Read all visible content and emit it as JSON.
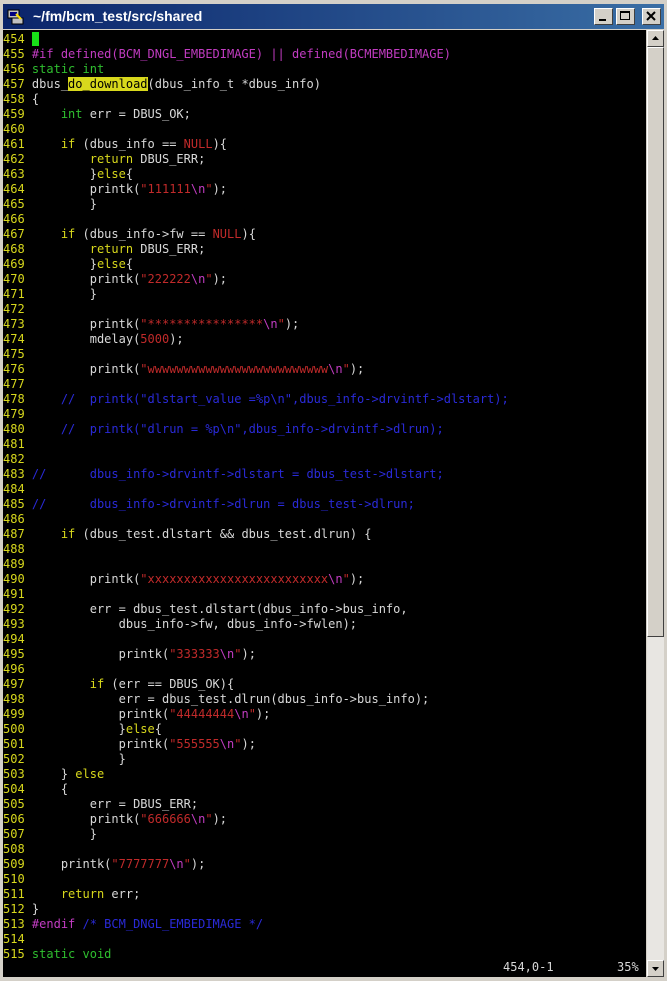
{
  "window": {
    "title": "~/fm/bcm_test/src/shared",
    "icon": "putty-terminal-icon"
  },
  "colors": {
    "linenum": "#d8d81c",
    "type": "#2fbf2f",
    "preproc": "#c23cc2",
    "keyword": "#d8d81c",
    "comment": "#2a2ad8",
    "string": "#c02a2a",
    "number": "#c02a2a",
    "special": "#c23cc2",
    "normal": "#d8d8d8",
    "search_hl": "#d8d81c",
    "cursor": "#18e018"
  },
  "lines": [
    {
      "n": "454",
      "cursor": true,
      "t": []
    },
    {
      "n": "455",
      "t": [
        [
          "pp",
          "#if defined(BCM_DNGL_EMBEDIMAGE) || defined(BCMEMBEDIMAGE)"
        ]
      ]
    },
    {
      "n": "456",
      "t": [
        [
          "ty",
          "static int"
        ]
      ]
    },
    {
      "n": "457",
      "t": [
        [
          "pl",
          "dbus_"
        ],
        [
          "hl",
          "do_download"
        ],
        [
          "pl",
          "(dbus_info_t *dbus_info)"
        ]
      ]
    },
    {
      "n": "458",
      "t": [
        [
          "pl",
          "{"
        ]
      ]
    },
    {
      "n": "459",
      "t": [
        [
          "pl",
          "    "
        ],
        [
          "ty",
          "int"
        ],
        [
          "pl",
          " err = DBUS_OK;"
        ]
      ]
    },
    {
      "n": "460",
      "t": []
    },
    {
      "n": "461",
      "t": [
        [
          "pl",
          "    "
        ],
        [
          "kw",
          "if"
        ],
        [
          "pl",
          " (dbus_info == "
        ],
        [
          "nul",
          "NULL"
        ],
        [
          "pl",
          "){"
        ]
      ]
    },
    {
      "n": "462",
      "t": [
        [
          "pl",
          "        "
        ],
        [
          "kw",
          "return"
        ],
        [
          "pl",
          " DBUS_ERR;"
        ]
      ]
    },
    {
      "n": "463",
      "t": [
        [
          "pl",
          "        }"
        ],
        [
          "kw",
          "else"
        ],
        [
          "pl",
          "{"
        ]
      ]
    },
    {
      "n": "464",
      "t": [
        [
          "pl",
          "        printk("
        ],
        [
          "st",
          "\"111111"
        ],
        [
          "sp",
          "\\n"
        ],
        [
          "st",
          "\""
        ],
        [
          "pl",
          ");"
        ]
      ]
    },
    {
      "n": "465",
      "t": [
        [
          "pl",
          "        }"
        ]
      ]
    },
    {
      "n": "466",
      "t": []
    },
    {
      "n": "467",
      "t": [
        [
          "pl",
          "    "
        ],
        [
          "kw",
          "if"
        ],
        [
          "pl",
          " (dbus_info->fw == "
        ],
        [
          "nul",
          "NULL"
        ],
        [
          "pl",
          "){"
        ]
      ]
    },
    {
      "n": "468",
      "t": [
        [
          "pl",
          "        "
        ],
        [
          "kw",
          "return"
        ],
        [
          "pl",
          " DBUS_ERR;"
        ]
      ]
    },
    {
      "n": "469",
      "t": [
        [
          "pl",
          "        }"
        ],
        [
          "kw",
          "else"
        ],
        [
          "pl",
          "{"
        ]
      ]
    },
    {
      "n": "470",
      "t": [
        [
          "pl",
          "        printk("
        ],
        [
          "st",
          "\"222222"
        ],
        [
          "sp",
          "\\n"
        ],
        [
          "st",
          "\""
        ],
        [
          "pl",
          ");"
        ]
      ]
    },
    {
      "n": "471",
      "t": [
        [
          "pl",
          "        }"
        ]
      ]
    },
    {
      "n": "472",
      "t": []
    },
    {
      "n": "473",
      "t": [
        [
          "pl",
          "        printk("
        ],
        [
          "st",
          "\"****************"
        ],
        [
          "sp",
          "\\n"
        ],
        [
          "st",
          "\""
        ],
        [
          "pl",
          ");"
        ]
      ]
    },
    {
      "n": "474",
      "t": [
        [
          "pl",
          "        mdelay("
        ],
        [
          "nu",
          "5000"
        ],
        [
          "pl",
          ");"
        ]
      ]
    },
    {
      "n": "475",
      "t": []
    },
    {
      "n": "476",
      "t": [
        [
          "pl",
          "        printk("
        ],
        [
          "st",
          "\"wwwwwwwwwwwwwwwwwwwwwwwww"
        ],
        [
          "sp",
          "\\n"
        ],
        [
          "st",
          "\""
        ],
        [
          "pl",
          ");"
        ]
      ]
    },
    {
      "n": "477",
      "t": []
    },
    {
      "n": "478",
      "t": [
        [
          "cm",
          "    //  printk(\"dlstart_value =%p\\n\",dbus_info->drvintf->dlstart);"
        ]
      ]
    },
    {
      "n": "479",
      "t": []
    },
    {
      "n": "480",
      "t": [
        [
          "cm",
          "    //  printk(\"dlrun = %p\\n\",dbus_info->drvintf->dlrun);"
        ]
      ]
    },
    {
      "n": "481",
      "t": []
    },
    {
      "n": "482",
      "t": []
    },
    {
      "n": "483",
      "t": [
        [
          "cm",
          "//      dbus_info->drvintf->dlstart = dbus_test->dlstart;"
        ]
      ]
    },
    {
      "n": "484",
      "t": []
    },
    {
      "n": "485",
      "t": [
        [
          "cm",
          "//      dbus_info->drvintf->dlrun = dbus_test->dlrun;"
        ]
      ]
    },
    {
      "n": "486",
      "t": []
    },
    {
      "n": "487",
      "t": [
        [
          "pl",
          "    "
        ],
        [
          "kw",
          "if"
        ],
        [
          "pl",
          " (dbus_test.dlstart && dbus_test.dlrun) {"
        ]
      ]
    },
    {
      "n": "488",
      "t": []
    },
    {
      "n": "489",
      "t": []
    },
    {
      "n": "490",
      "t": [
        [
          "pl",
          "        printk("
        ],
        [
          "st",
          "\"xxxxxxxxxxxxxxxxxxxxxxxxx"
        ],
        [
          "sp",
          "\\n"
        ],
        [
          "st",
          "\""
        ],
        [
          "pl",
          ");"
        ]
      ]
    },
    {
      "n": "491",
      "t": []
    },
    {
      "n": "492",
      "t": [
        [
          "pl",
          "        err = dbus_test.dlstart(dbus_info->bus_info,"
        ]
      ]
    },
    {
      "n": "493",
      "t": [
        [
          "pl",
          "            dbus_info->fw, dbus_info->fwlen);"
        ]
      ]
    },
    {
      "n": "494",
      "t": []
    },
    {
      "n": "495",
      "t": [
        [
          "pl",
          "            printk("
        ],
        [
          "st",
          "\"333333"
        ],
        [
          "sp",
          "\\n"
        ],
        [
          "st",
          "\""
        ],
        [
          "pl",
          ");"
        ]
      ]
    },
    {
      "n": "496",
      "t": []
    },
    {
      "n": "497",
      "t": [
        [
          "pl",
          "        "
        ],
        [
          "kw",
          "if"
        ],
        [
          "pl",
          " (err == DBUS_OK){"
        ]
      ]
    },
    {
      "n": "498",
      "t": [
        [
          "pl",
          "            err = dbus_test.dlrun(dbus_info->bus_info);"
        ]
      ]
    },
    {
      "n": "499",
      "t": [
        [
          "pl",
          "            printk("
        ],
        [
          "st",
          "\"44444444"
        ],
        [
          "sp",
          "\\n"
        ],
        [
          "st",
          "\""
        ],
        [
          "pl",
          ");"
        ]
      ]
    },
    {
      "n": "500",
      "t": [
        [
          "pl",
          "            }"
        ],
        [
          "kw",
          "else"
        ],
        [
          "pl",
          "{"
        ]
      ]
    },
    {
      "n": "501",
      "t": [
        [
          "pl",
          "            printk("
        ],
        [
          "st",
          "\"555555"
        ],
        [
          "sp",
          "\\n"
        ],
        [
          "st",
          "\""
        ],
        [
          "pl",
          ");"
        ]
      ]
    },
    {
      "n": "502",
      "t": [
        [
          "pl",
          "            }"
        ]
      ]
    },
    {
      "n": "503",
      "t": [
        [
          "pl",
          "    } "
        ],
        [
          "kw",
          "else"
        ]
      ]
    },
    {
      "n": "504",
      "t": [
        [
          "pl",
          "    {"
        ]
      ]
    },
    {
      "n": "505",
      "t": [
        [
          "pl",
          "        err = DBUS_ERR;"
        ]
      ]
    },
    {
      "n": "506",
      "t": [
        [
          "pl",
          "        printk("
        ],
        [
          "st",
          "\"666666"
        ],
        [
          "sp",
          "\\n"
        ],
        [
          "st",
          "\""
        ],
        [
          "pl",
          ");"
        ]
      ]
    },
    {
      "n": "507",
      "t": [
        [
          "pl",
          "        }"
        ]
      ]
    },
    {
      "n": "508",
      "t": []
    },
    {
      "n": "509",
      "t": [
        [
          "pl",
          "    printk("
        ],
        [
          "st",
          "\"7777777"
        ],
        [
          "sp",
          "\\n"
        ],
        [
          "st",
          "\""
        ],
        [
          "pl",
          ");"
        ]
      ]
    },
    {
      "n": "510",
      "t": []
    },
    {
      "n": "511",
      "t": [
        [
          "pl",
          "    "
        ],
        [
          "kw",
          "return"
        ],
        [
          "pl",
          " err;"
        ]
      ]
    },
    {
      "n": "512",
      "t": [
        [
          "pl",
          "}"
        ]
      ]
    },
    {
      "n": "513",
      "t": [
        [
          "pp",
          "#endif"
        ],
        [
          "cm",
          " /* BCM_DNGL_EMBEDIMAGE */"
        ]
      ]
    },
    {
      "n": "514",
      "t": []
    },
    {
      "n": "515",
      "t": [
        [
          "ty",
          "static void"
        ]
      ]
    }
  ],
  "status": {
    "position": "454,0-1",
    "percent": "35%"
  }
}
